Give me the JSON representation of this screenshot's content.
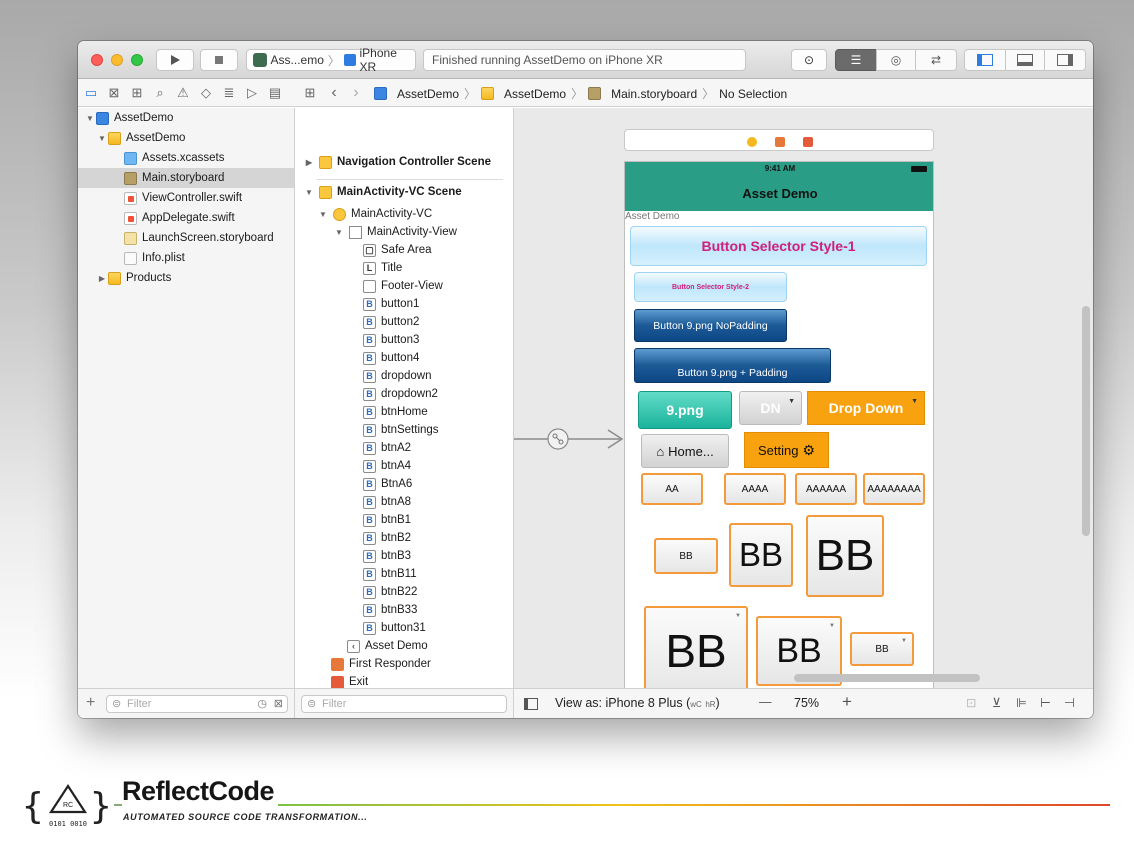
{
  "titlebar": {
    "scheme_app": "Ass...emo",
    "scheme_device": "iPhone XR",
    "status": "Finished running AssetDemo on iPhone XR"
  },
  "breadcrumb": [
    "AssetDemo",
    "AssetDemo",
    "Main.storyboard",
    "No Selection"
  ],
  "navigator": {
    "items": [
      {
        "label": "AssetDemo",
        "indent": 0,
        "icon": "project-icon",
        "disclosure": "open"
      },
      {
        "label": "AssetDemo",
        "indent": 1,
        "icon": "folder-icon",
        "disclosure": "open"
      },
      {
        "label": "Assets.xcassets",
        "indent": 2,
        "icon": "xcassets-icon"
      },
      {
        "label": "Main.storyboard",
        "indent": 2,
        "icon": "storyboard-icon",
        "selected": true
      },
      {
        "label": "ViewController.swift",
        "indent": 2,
        "icon": "swift-file-icon"
      },
      {
        "label": "AppDelegate.swift",
        "indent": 2,
        "icon": "swift-file-icon"
      },
      {
        "label": "LaunchScreen.storyboard",
        "indent": 2,
        "icon": "storyboard-icon"
      },
      {
        "label": "Info.plist",
        "indent": 2,
        "icon": "plist-icon"
      },
      {
        "label": "Products",
        "indent": 1,
        "icon": "folder-icon",
        "disclosure": "closed"
      }
    ],
    "filter_placeholder": "Filter"
  },
  "outline": {
    "nav_scene": "Navigation Controller Scene",
    "vc_scene": "MainActivity-VC Scene",
    "vc": "MainActivity-VC",
    "view": "MainActivity-View",
    "children": [
      {
        "badge": "▢",
        "label": "Safe Area"
      },
      {
        "badge": "L",
        "label": "Title"
      },
      {
        "badge": "",
        "label": "Footer-View"
      },
      {
        "badge": "B",
        "label": "button1"
      },
      {
        "badge": "B",
        "label": "button2"
      },
      {
        "badge": "B",
        "label": "button3"
      },
      {
        "badge": "B",
        "label": "button4"
      },
      {
        "badge": "B",
        "label": "dropdown"
      },
      {
        "badge": "B",
        "label": "dropdown2"
      },
      {
        "badge": "B",
        "label": "btnHome"
      },
      {
        "badge": "B",
        "label": "btnSettings"
      },
      {
        "badge": "B",
        "label": "btnA2"
      },
      {
        "badge": "B",
        "label": "btnA4"
      },
      {
        "badge": "B",
        "label": "BtnA6"
      },
      {
        "badge": "B",
        "label": "btnA8"
      },
      {
        "badge": "B",
        "label": "btnB1"
      },
      {
        "badge": "B",
        "label": "btnB2"
      },
      {
        "badge": "B",
        "label": "btnB3"
      },
      {
        "badge": "B",
        "label": "btnB11"
      },
      {
        "badge": "B",
        "label": "btnB22"
      },
      {
        "badge": "B",
        "label": "btnB33"
      },
      {
        "badge": "B",
        "label": "button31"
      }
    ],
    "nav_item": "Asset Demo",
    "first_responder": "First Responder",
    "exit": "Exit",
    "filter_placeholder": "Filter"
  },
  "device": {
    "time": "9:41 AM",
    "nav_title": "Asset Demo",
    "title_label": "Asset Demo",
    "btn_style1": "Button Selector Style-1",
    "btn_style2": "Button Selector Style-2",
    "btn_nopad": "Button 9.png NoPadding",
    "btn_pad": "Button 9.png + Padding",
    "btn_9png": "9.png",
    "btn_dn": "DN",
    "btn_dropdown": "Drop Down",
    "btn_home": "Home...",
    "btn_setting": "Setting",
    "btn_aa": "AA",
    "btn_aaaa": "AAAA",
    "btn_aaaaaa": "AAAAAA",
    "btn_aaaaaaaa": "AAAAAAAA",
    "btn_bb": "BB"
  },
  "bottom_bar": {
    "view_as": "View as: iPhone 8 Plus (",
    "size_class_w": "wC",
    "size_class_h": "hR",
    "view_as_end": ")",
    "zoom_out": "—",
    "zoom": "75%",
    "zoom_in": "+"
  },
  "logo": {
    "name": "ReflectCode",
    "tagline": "AUTOMATED SOURCE CODE TRANSFORMATION...",
    "badge_top": "RC",
    "badge_bottom": "0101 0010"
  },
  "colors": {
    "accent_teal": "#2a9d86",
    "orange": "#f8a20f",
    "magenta_text": "#d0207a"
  }
}
